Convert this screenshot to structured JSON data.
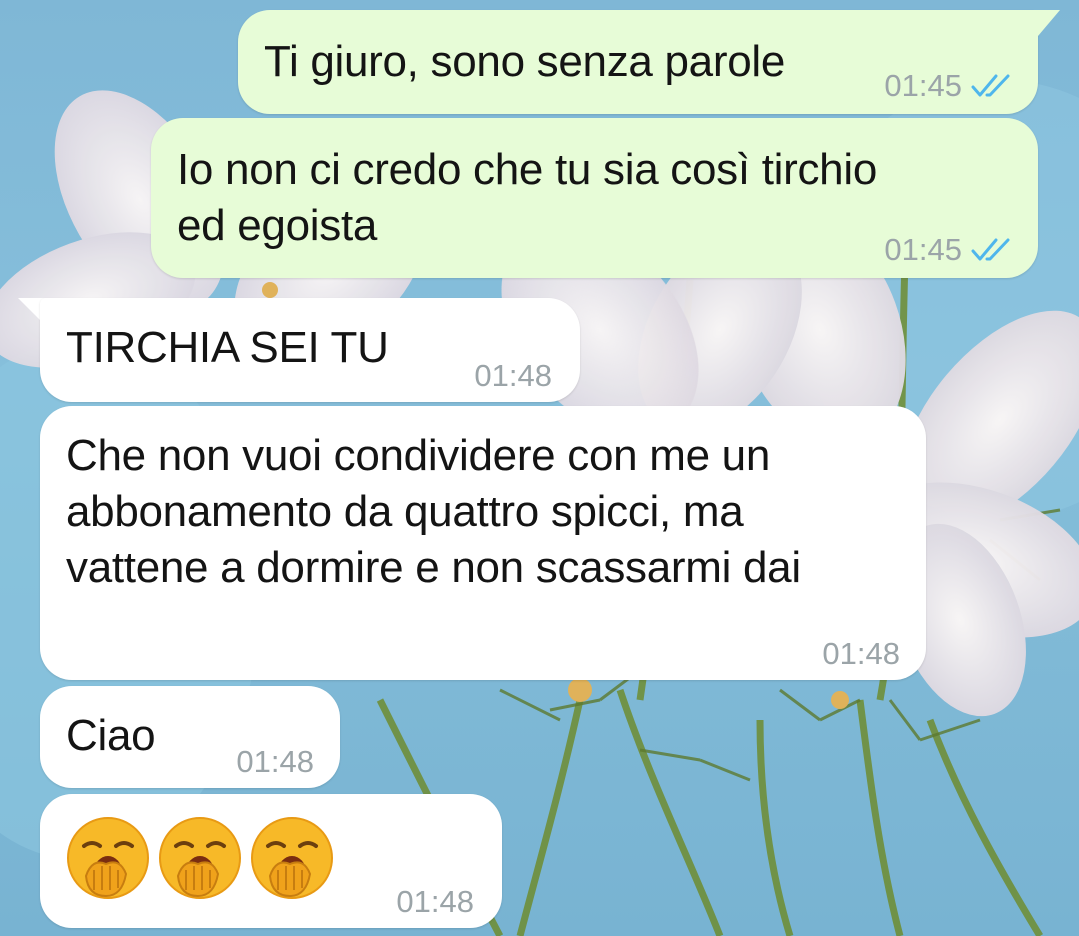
{
  "chat": {
    "messages": [
      {
        "direction": "outgoing",
        "text": "Ti giuro, sono senza parole",
        "time": "01:45",
        "status": "double-tick-read"
      },
      {
        "direction": "outgoing",
        "text": "Io non ci credo che tu sia così tirchio\ned egoista",
        "time": "01:45",
        "status": "double-tick-read"
      },
      {
        "direction": "incoming",
        "text": "TIRCHIA SEI TU",
        "time": "01:48"
      },
      {
        "direction": "incoming",
        "text": "Che non vuoi condividere con me un\nabbonamento da quattro spicci, ma\nvattene a dormire e non scassarmi dai",
        "time": "01:48"
      },
      {
        "direction": "incoming",
        "text": "Ciao",
        "time": "01:48"
      },
      {
        "direction": "incoming",
        "emoji": [
          "yawning-face",
          "yawning-face",
          "yawning-face"
        ],
        "time": "01:48"
      }
    ]
  },
  "colors": {
    "outgoing_bubble": "#e7fcd7",
    "incoming_bubble": "#ffffff",
    "read_ticks": "#4fb6ec",
    "timestamp": "#9ba4a8"
  }
}
